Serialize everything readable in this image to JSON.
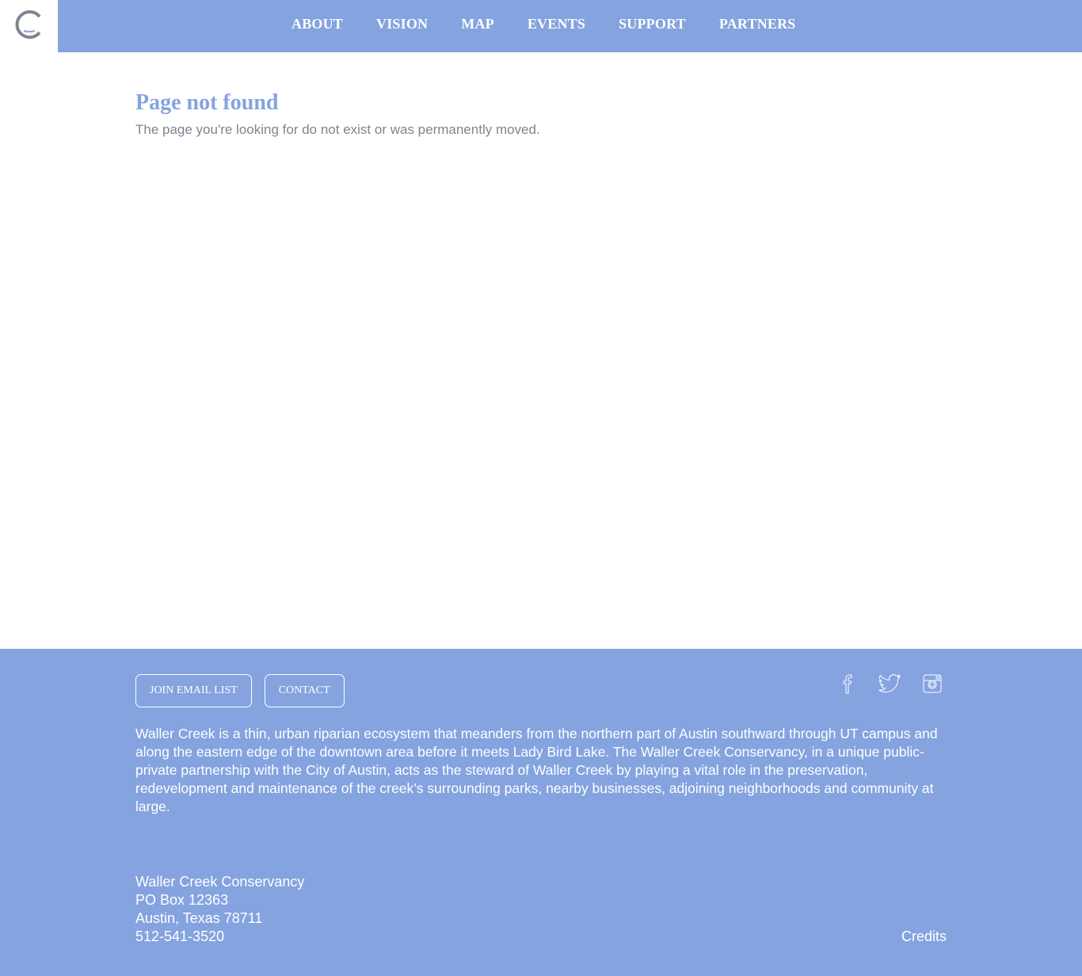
{
  "nav": {
    "items": [
      {
        "label": "ABOUT"
      },
      {
        "label": "VISION"
      },
      {
        "label": "MAP"
      },
      {
        "label": "EVENTS"
      },
      {
        "label": "SUPPORT"
      },
      {
        "label": "PARTNERS"
      }
    ]
  },
  "logo": {
    "icon": "c-logo-icon"
  },
  "main": {
    "title": "Page not found",
    "message": "The page you're looking for do not exist or was permanently moved."
  },
  "footer": {
    "buttons": {
      "join": "JOIN EMAIL LIST",
      "contact": "CONTACT"
    },
    "social": [
      "facebook-icon",
      "twitter-icon",
      "instagram-icon"
    ],
    "about": "Waller Creek is a thin, urban riparian ecosystem that meanders from the northern part of Austin southward through UT campus and along the eastern edge of the downtown area before it meets Lady Bird Lake. The Waller Creek Conservancy, in a unique public-private partnership with the City of Austin, acts as the steward of Waller Creek by playing a vital role in the preservation, redevelopment and maintenance of the creek’s surrounding parks, nearby businesses, adjoining neighborhoods and community at large.",
    "address": {
      "org": "Waller Creek Conservancy",
      "po": "PO Box 12363",
      "city": "Austin, Texas 78711",
      "phone": "512-541-3520"
    },
    "credits": "Credits"
  },
  "colors": {
    "accent": "#84a3df",
    "text_gray": "#7f8590",
    "white": "#ffffff"
  }
}
